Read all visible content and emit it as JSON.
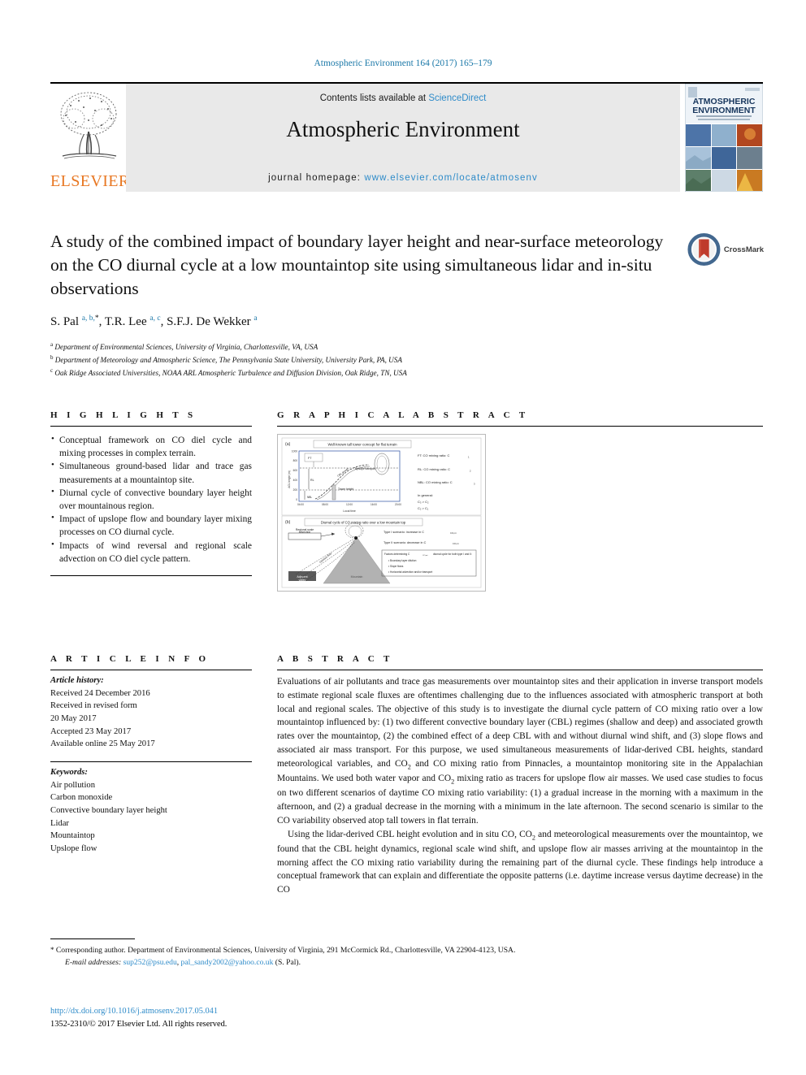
{
  "running_head": "Atmospheric Environment 164 (2017) 165–179",
  "masthead": {
    "publisher": "ELSEVIER",
    "contents_prefix": "Contents lists available at ",
    "contents_link": "ScienceDirect",
    "journal_title": "Atmospheric Environment",
    "homepage_prefix": "journal homepage: ",
    "homepage_url": "www.elsevier.com/locate/atmosenv",
    "cover_title_line1": "ATMOSPHERIC",
    "cover_title_line2": "ENVIRONMENT"
  },
  "colors": {
    "link_blue": "#2e8bc9",
    "running_head_blue": "#1b78a8",
    "elsevier_orange": "#e87722",
    "masthead_grey": "#e9e9e9",
    "crossmark_blue": "#2f6fa8",
    "crossmark_red": "#c0392b"
  },
  "article": {
    "title": "A study of the combined impact of boundary layer height and near-surface meteorology on the CO diurnal cycle at a low mountaintop site using simultaneous lidar and in-situ observations",
    "authors_html": "S. Pal <sup>a, b, *</sup>, T.R. Lee <sup>a, c</sup>, S.F.J. De Wekker <sup>a</sup>",
    "affiliations": [
      {
        "marker": "a",
        "text": "Department of Environmental Sciences, University of Virginia, Charlottesville, VA, USA"
      },
      {
        "marker": "b",
        "text": "Department of Meteorology and Atmospheric Science, The Pennsylvania State University, University Park, PA, USA"
      },
      {
        "marker": "c",
        "text": "Oak Ridge Associated Universities, NOAA ARL Atmospheric Turbulence and Diffusion Division, Oak Ridge, TN, USA"
      }
    ],
    "crossmark_label": "CrossMark"
  },
  "highlights": {
    "heading": "H I G H L I G H T S",
    "items": [
      "Conceptual framework on CO diel cycle and mixing processes in complex terrain.",
      "Simultaneous ground-based lidar and trace gas measurements at a mountaintop site.",
      "Diurnal cycle of convective boundary layer height over mountainous region.",
      "Impact of upslope flow and boundary layer mixing processes on CO diurnal cycle.",
      "Impacts of wind reversal and regional scale advection on CO diel cycle pattern."
    ]
  },
  "graphical_abstract": {
    "heading": "G R A P H I C A L   A B S T R A C T",
    "panel_a": {
      "tag": "(a)",
      "title": "Well-known tall tower concept for flat terrain",
      "ylabel": "AGL height (m a.g.l.)",
      "xlabel": "Local time",
      "yticks": [
        "0",
        "200",
        "400",
        "600",
        "800",
        "1000"
      ],
      "xticks": [
        "04:00",
        "08:00",
        "12:00",
        "16:00",
        "20:00"
      ],
      "labels": [
        "FT",
        "CBL",
        "RBL",
        "Tower height",
        "Upslope transport"
      ],
      "legend": [
        "FT: CO mixing ratio: C₁",
        "RL: CO mixing ratio: C₂",
        "NBL: CO mixing ratio: C₃",
        "In general:",
        "C₃ > C₂",
        "C₂ > C₁"
      ]
    },
    "panel_b": {
      "tag": "(b)",
      "title": "Diurnal cycle of CO mixing ratio over a low mountain top",
      "labels": [
        "Regional scale advection",
        "Upslope flow",
        "Adjacent valley",
        "Mountain",
        "Type I scenario: increase in C_CO,mt",
        "Type II scenario: decrease in C_CO,mt",
        "Factors determining C_CO,mt diurnal cycle for both type I and II:",
        "Boundary layer dilution",
        "Slope flows",
        "Horizontal advection and/or transport"
      ]
    }
  },
  "article_info": {
    "heading": "A R T I C L E   I N F O",
    "history_label": "Article history:",
    "history": [
      "Received 24 December 2016",
      "Received in revised form",
      "20 May 2017",
      "Accepted 23 May 2017",
      "Available online 25 May 2017"
    ],
    "keywords_label": "Keywords:",
    "keywords": [
      "Air pollution",
      "Carbon monoxide",
      "Convective boundary layer height",
      "Lidar",
      "Mountaintop",
      "Upslope flow"
    ]
  },
  "abstract": {
    "heading": "A B S T R A C T",
    "paragraph_1_part1": "Evaluations of air pollutants and trace gas measurements over mountaintop sites and their application in inverse transport models to estimate regional scale fluxes are oftentimes challenging due to the influences associated with atmospheric transport at both local and regional scales. The objective of this study is to investigate the diurnal cycle pattern of CO mixing ratio over a low mountaintop influenced by: (1) two different convective boundary layer (CBL) regimes (shallow and deep) and associated growth rates over the mountaintop, (2) the combined effect of a deep CBL with and without diurnal wind shift, and (3) slope flows and associated air mass transport. For this purpose, we used simultaneous measurements of lidar-derived CBL heights, standard meteorological variables, and CO",
    "paragraph_1_sub": "2",
    "paragraph_1_part2": " and CO mixing ratio from Pinnacles, a mountaintop monitoring site in the Appalachian Mountains. We used both water vapor and CO",
    "paragraph_1_sub2": "2",
    "paragraph_1_part3": " mixing ratio as tracers for upslope flow air masses. We used case studies to focus on two different scenarios of daytime CO mixing ratio variability: (1) a gradual increase in the morning with a maximum in the afternoon, and (2) a gradual decrease in the morning with a minimum in the late afternoon. The second scenario is similar to the CO variability observed atop tall towers in flat terrain.",
    "paragraph_2_part1": "Using the lidar-derived CBL height evolution and in situ CO, CO",
    "paragraph_2_sub": "2",
    "paragraph_2_part2": " and meteorological measurements over the mountaintop, we found that the CBL height dynamics, regional scale wind shift, and upslope flow air masses arriving at the mountaintop in the morning affect the CO mixing ratio variability during the remaining part of the diurnal cycle. These findings help introduce a conceptual framework that can explain and differentiate the opposite patterns (i.e. daytime increase versus daytime decrease) in the CO"
  },
  "footnotes": {
    "corresponding_marker": "*",
    "corresponding_text": "Corresponding author. Department of Environmental Sciences, University of Virginia, 291 McCormick Rd., Charlottesville, VA 22904-4123, USA.",
    "email_label": "E-mail addresses:",
    "email_1": "sup252@psu.edu",
    "email_2": "pal_sandy2002@yahoo.co.uk",
    "email_suffix": "(S. Pal).",
    "doi": "http://dx.doi.org/10.1016/j.atmosenv.2017.05.041",
    "copyright": "1352-2310/© 2017 Elsevier Ltd. All rights reserved."
  }
}
